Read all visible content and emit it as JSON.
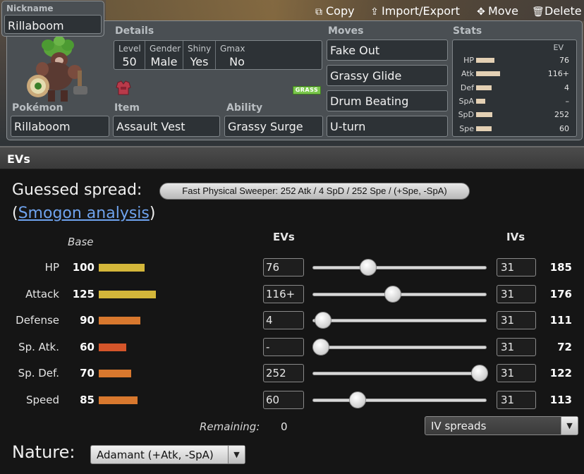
{
  "toolbar": {
    "copy": "Copy",
    "import_export": "Import/Export",
    "move": "Move",
    "delete": "Delete"
  },
  "set": {
    "nickname_label": "Nickname",
    "nickname": "Rillaboom",
    "details_label": "Details",
    "level_label": "Level",
    "level": "50",
    "gender_label": "Gender",
    "gender": "Male",
    "shiny_label": "Shiny",
    "shiny": "Yes",
    "gmax_label": "Gmax",
    "gmax": "No",
    "pokemon_label": "Pokémon",
    "pokemon": "Rillaboom",
    "item_label": "Item",
    "item": "Assault Vest",
    "ability_label": "Ability",
    "ability": "Grassy Surge",
    "type": "GRASS",
    "moves_label": "Moves",
    "moves": [
      "Fake Out",
      "Grassy Glide",
      "Drum Beating",
      "U-turn"
    ]
  },
  "stats_panel": {
    "label": "Stats",
    "ev_header": "EV",
    "rows": [
      {
        "name": "HP",
        "ev": "76",
        "bar_fraction": 0.33
      },
      {
        "name": "Atk",
        "ev": "116+",
        "bar_fraction": 0.43
      },
      {
        "name": "Def",
        "ev": "4",
        "bar_fraction": 0.27
      },
      {
        "name": "SpA",
        "ev": "–",
        "bar_fraction": 0.16
      },
      {
        "name": "SpD",
        "ev": "252",
        "bar_fraction": 0.29
      },
      {
        "name": "Spe",
        "ev": "60",
        "bar_fraction": 0.28
      }
    ]
  },
  "evs": {
    "header": "EVs",
    "guessed_label": "Guessed spread:",
    "guessed_spread": "Fast Physical Sweeper: 252 Atk / 4 SpD / 252 Spe / (+Spe, -SpA)",
    "smogon_open": "(",
    "smogon_link": "Smogon analysis",
    "smogon_close": ")",
    "base_header": "Base",
    "evs_header": "EVs",
    "ivs_header": "IVs",
    "stats": [
      {
        "name": "HP",
        "base": "100",
        "ev": "76",
        "iv": "31",
        "total": "185",
        "slider_fraction": 0.32,
        "bar_color": "#d4b73a"
      },
      {
        "name": "Attack",
        "base": "125",
        "ev": "116+",
        "iv": "31",
        "total": "176",
        "slider_fraction": 0.46,
        "bar_color": "#d4b73a"
      },
      {
        "name": "Defense",
        "base": "90",
        "ev": "4",
        "iv": "31",
        "total": "111",
        "slider_fraction": 0.06,
        "bar_color": "#d8782e"
      },
      {
        "name": "Sp. Atk.",
        "base": "60",
        "ev": "-",
        "iv": "31",
        "total": "72",
        "slider_fraction": 0.05,
        "bar_color": "#d4552a"
      },
      {
        "name": "Sp. Def.",
        "base": "70",
        "ev": "252",
        "iv": "31",
        "total": "122",
        "slider_fraction": 0.96,
        "bar_color": "#d8782e"
      },
      {
        "name": "Speed",
        "base": "85",
        "ev": "60",
        "iv": "31",
        "total": "113",
        "slider_fraction": 0.26,
        "bar_color": "#d8782e"
      }
    ],
    "remaining_label": "Remaining:",
    "remaining": "0",
    "iv_spreads": "IV spreads",
    "nature_label": "Nature:",
    "nature": "Adamant (+Atk, -SpA)"
  }
}
